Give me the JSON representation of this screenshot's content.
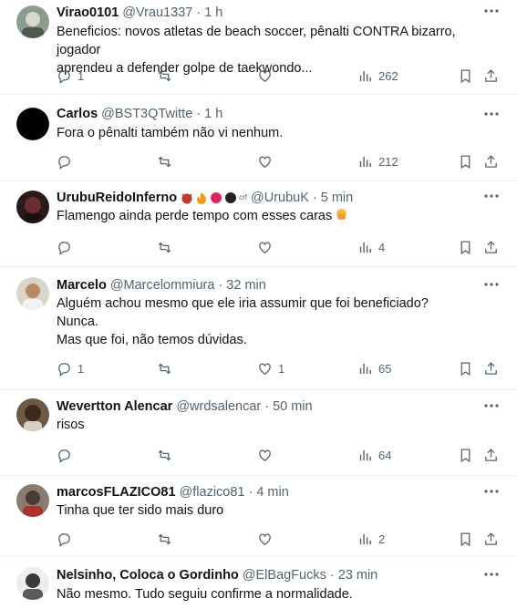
{
  "tweets": [
    {
      "name": "Virao0101",
      "handle": "@Vrau1337",
      "sep": "·",
      "time": "1 h",
      "lines": [
        "Beneficios: novos atletas de beach soccer, pênalti CONTRA bizarro, jogador",
        "aprendeu a defender golpe de taekwondo..."
      ],
      "replies": "1",
      "retweets": "",
      "likes": "",
      "views": "262",
      "avatar_color": "#7a8a7a"
    },
    {
      "name": "Carlos",
      "handle": "@BST3QTwitte",
      "sep": "·",
      "time": "1 h",
      "lines": [
        "Fora o pênalti também não vi nenhum."
      ],
      "replies": "",
      "retweets": "",
      "likes": "",
      "views": "212",
      "avatar_color": "#000000"
    },
    {
      "name": "UrubuReidoInferno",
      "handle": "@UrubuK",
      "sep": "·",
      "time": "5 min",
      "name_suffix": "crf",
      "lines": [
        "Flamengo ainda perde tempo com esses caras"
      ],
      "replies": "",
      "retweets": "",
      "likes": "",
      "views": "4",
      "avatar_color": "#3a1f1f"
    },
    {
      "name": "Marcelo",
      "handle": "@Marcelommiura",
      "sep": "·",
      "time": "32 min",
      "lines": [
        "Alguém achou mesmo que ele iria assumir que foi beneficiado?",
        "Nunca.",
        "Mas que foi, não temos dúvidas."
      ],
      "replies": "1",
      "retweets": "",
      "likes": "1",
      "views": "65",
      "avatar_color": "#b89a7a"
    },
    {
      "name": "Wevertton Alencar",
      "handle": "@wrdsalencar",
      "sep": "·",
      "time": "50 min",
      "lines": [
        "risos"
      ],
      "replies": "",
      "retweets": "",
      "likes": "",
      "views": "64",
      "avatar_color": "#4a3a2a"
    },
    {
      "name": "marcosFLAZICO81",
      "handle": "@flazico81",
      "sep": "·",
      "time": "4 min",
      "lines": [
        "Tinha que ter sido mais duro"
      ],
      "replies": "",
      "retweets": "",
      "likes": "",
      "views": "2",
      "avatar_color": "#5a4a44"
    },
    {
      "name": "Nelsinho, Coloca o Gordinho",
      "handle": "@ElBagFucks",
      "sep": "·",
      "time": "23 min",
      "lines": [
        "Não mesmo. Tudo seguiu confirme a normalidade."
      ],
      "replies": "",
      "retweets": "",
      "likes": "",
      "views": "",
      "avatar_color": "#6a6a6a"
    }
  ],
  "colors": {
    "text": "#0f1419",
    "muted": "#536471",
    "divider": "#eff3f4"
  },
  "icons": [
    "reply-icon",
    "retweet-icon",
    "like-icon",
    "views-icon",
    "bookmark-icon",
    "share-icon",
    "more-icon"
  ]
}
